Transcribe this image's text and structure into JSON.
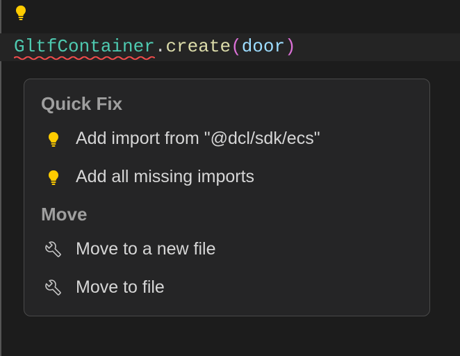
{
  "code": {
    "typeName": "GltfContainer",
    "dot": ".",
    "method": "create",
    "lparen": "(",
    "arg": "door",
    "rparen": ")"
  },
  "popup": {
    "sections": [
      {
        "title": "Quick Fix",
        "items": [
          {
            "icon": "lightbulb",
            "label": "Add import from \"@dcl/sdk/ecs\""
          },
          {
            "icon": "lightbulb",
            "label": "Add all missing imports"
          }
        ]
      },
      {
        "title": "Move",
        "items": [
          {
            "icon": "wrench",
            "label": "Move to a new file"
          },
          {
            "icon": "wrench",
            "label": "Move to file"
          }
        ]
      }
    ]
  },
  "colors": {
    "bulb": "#ffcc00",
    "squiggle": "#f14c4c",
    "wrench": "#c5c5c5"
  }
}
